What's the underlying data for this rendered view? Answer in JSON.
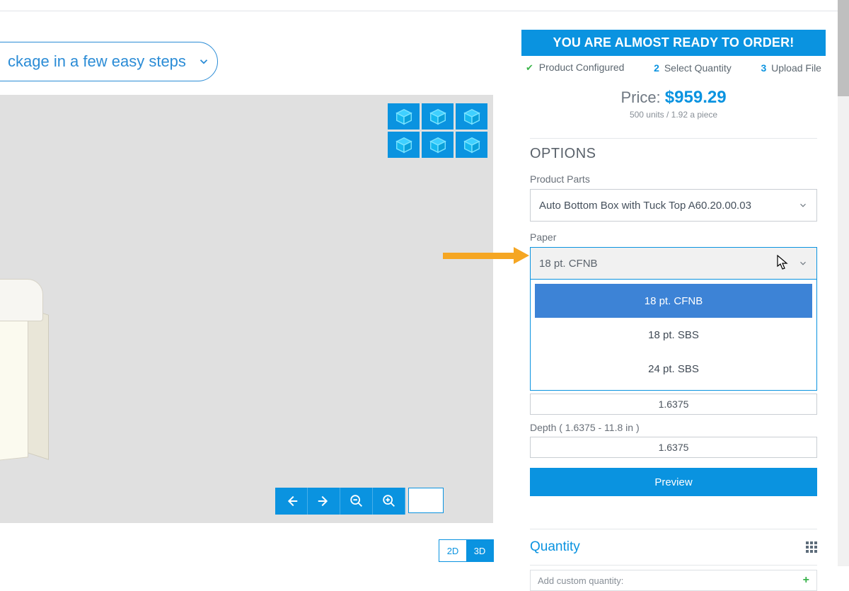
{
  "header": {
    "pill_text": "ckage in a few easy steps"
  },
  "viewer": {
    "toggle2d": "2D",
    "toggle3d": "3D"
  },
  "steps": {
    "s1": "Product Configured",
    "s2_num": "2",
    "s2": "Select Quantity",
    "s3_num": "3",
    "s3": "Upload File"
  },
  "banner": "YOU ARE ALMOST READY TO ORDER!",
  "price": {
    "label": "Price: ",
    "value": "$959.29",
    "sub": "500 units / 1.92 a piece"
  },
  "options": {
    "heading": "OPTIONS",
    "product_parts_label": "Product Parts",
    "product_parts_value": "Auto Bottom Box with Tuck Top A60.20.00.03",
    "paper_label": "Paper",
    "paper_selected": "18 pt. CFNB",
    "paper_choices": [
      "18 pt. CFNB",
      "18 pt. SBS",
      "24 pt. SBS"
    ],
    "dim_value": "1.6375",
    "depth_label": "Depth ( 1.6375 - 11.8 in )",
    "depth_value": "1.6375",
    "preview": "Preview"
  },
  "quantity": {
    "title": "Quantity",
    "add_placeholder": "Add custom quantity:"
  }
}
